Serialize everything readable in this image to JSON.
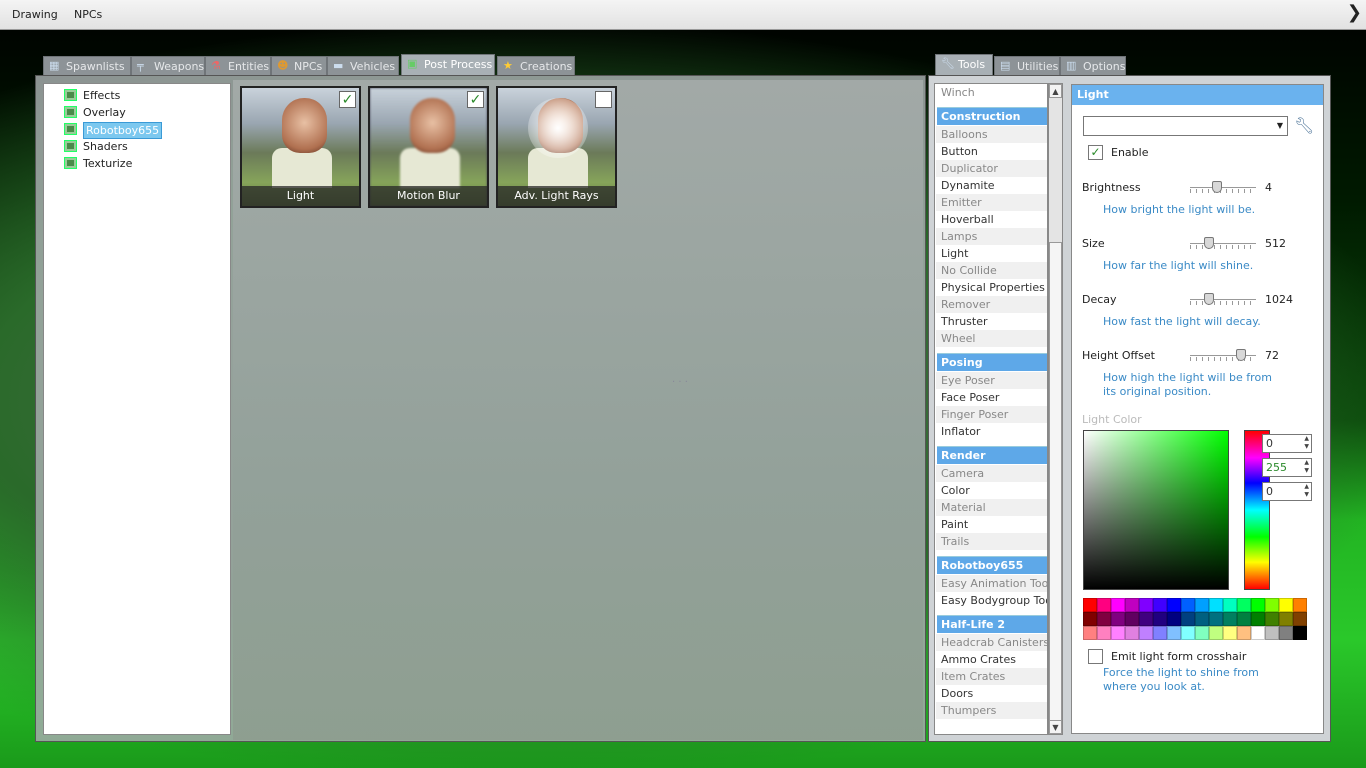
{
  "menubar": {
    "items": [
      "Drawing",
      "NPCs"
    ]
  },
  "spawn_tabs": [
    {
      "label": "Spawnlists",
      "icon": "grid-icon"
    },
    {
      "label": "Weapons",
      "icon": "gun-icon"
    },
    {
      "label": "Entities",
      "icon": "flask-icon"
    },
    {
      "label": "NPCs",
      "icon": "monkey-icon"
    },
    {
      "label": "Vehicles",
      "icon": "car-icon"
    },
    {
      "label": "Post Process",
      "icon": "image-icon",
      "active": true
    },
    {
      "label": "Creations",
      "icon": "star-icon"
    }
  ],
  "tree": {
    "items": [
      "Effects",
      "Overlay",
      "Robotboy655",
      "Shaders",
      "Texturize"
    ],
    "selected": "Robotboy655"
  },
  "thumbs": [
    {
      "label": "Light",
      "checked": "✓"
    },
    {
      "label": "Motion Blur",
      "checked": "✓"
    },
    {
      "label": "Adv. Light Rays",
      "checked": ""
    }
  ],
  "tool_tabs": [
    {
      "label": "Tools",
      "icon": "wrench-icon",
      "active": true
    },
    {
      "label": "Utilities",
      "icon": "utilities-icon"
    },
    {
      "label": "Options",
      "icon": "options-icon"
    }
  ],
  "toollist": {
    "top_item": "Winch",
    "categories": [
      {
        "name": "Construction",
        "items": [
          "Balloons",
          "Button",
          "Duplicator",
          "Dynamite",
          "Emitter",
          "Hoverball",
          "Lamps",
          "Light",
          "No Collide",
          "Physical Properties",
          "Remover",
          "Thruster",
          "Wheel"
        ]
      },
      {
        "name": "Posing",
        "items": [
          "Eye Poser",
          "Face Poser",
          "Finger Poser",
          "Inflator"
        ]
      },
      {
        "name": "Render",
        "items": [
          "Camera",
          "Color",
          "Material",
          "Paint",
          "Trails"
        ]
      },
      {
        "name": "Robotboy655",
        "items": [
          "Easy Animation Tool",
          "Easy Bodygroup Tool"
        ]
      },
      {
        "name": "Half-Life 2",
        "items": [
          "Headcrab Canisters",
          "Ammo Crates",
          "Item Crates",
          "Doors",
          "Thumpers"
        ]
      }
    ]
  },
  "panel": {
    "title": "Light",
    "preset_value": "",
    "enable_label": "Enable",
    "enable_checked": "✓",
    "brightness": {
      "label": "Brightness",
      "value": "4",
      "help": "How bright the light will be.",
      "level": 0.4
    },
    "size": {
      "label": "Size",
      "value": "512",
      "help": "How far the light will shine.",
      "level": 0.25
    },
    "decay": {
      "label": "Decay",
      "value": "1024",
      "help": "How fast the light will decay.",
      "level": 0.25
    },
    "height": {
      "label": "Height Offset",
      "value": "72",
      "help": "How high the light will be from its original position.",
      "level": 0.82
    },
    "color_label": "Light Color",
    "rgb": [
      "0",
      "255",
      "0"
    ],
    "crosshair_label": "Emit light form crosshair",
    "crosshair_help": "Force the light to shine from where you look at.",
    "crosshair_checked": ""
  },
  "palette": [
    "#ff0000",
    "#ff0080",
    "#ff00ff",
    "#c000c0",
    "#8000ff",
    "#4000ff",
    "#0000ff",
    "#0060ff",
    "#00a0ff",
    "#00e0ff",
    "#00ffc0",
    "#00ff60",
    "#00ff00",
    "#80ff00",
    "#ffff00",
    "#ff8000",
    "#800000",
    "#800040",
    "#800080",
    "#600060",
    "#400080",
    "#200080",
    "#000080",
    "#004080",
    "#006080",
    "#007080",
    "#008060",
    "#008040",
    "#008000",
    "#408000",
    "#808000",
    "#804000",
    "#ff8080",
    "#ff80c0",
    "#ff80ff",
    "#e080e0",
    "#c080ff",
    "#8080ff",
    "#80c0ff",
    "#80ffff",
    "#80ffc0",
    "#c0ff80",
    "#ffff80",
    "#ffc080",
    "#ffffff",
    "#c0c0c0",
    "#808080",
    "#000000"
  ]
}
